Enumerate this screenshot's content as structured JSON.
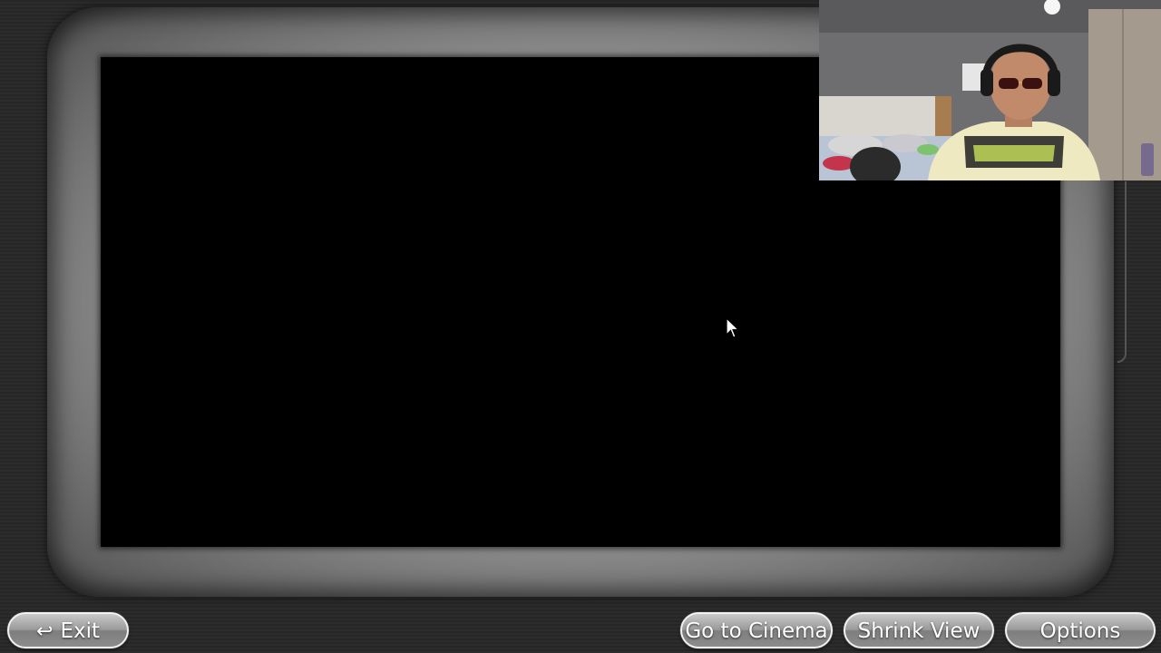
{
  "toolbar": {
    "exit_label": "Exit",
    "exit_icon": "return-arrow-icon",
    "cinema_label": "Go to Cinema",
    "shrink_label": "Shrink View",
    "options_label": "Options"
  },
  "colors": {
    "background": "#2a2a2a",
    "frame": "#8f8f8f",
    "video": "#000000",
    "button_text": "#ffffff",
    "focus_accent": "#8bc6c6"
  },
  "overlay": {
    "webcam_present": true
  }
}
